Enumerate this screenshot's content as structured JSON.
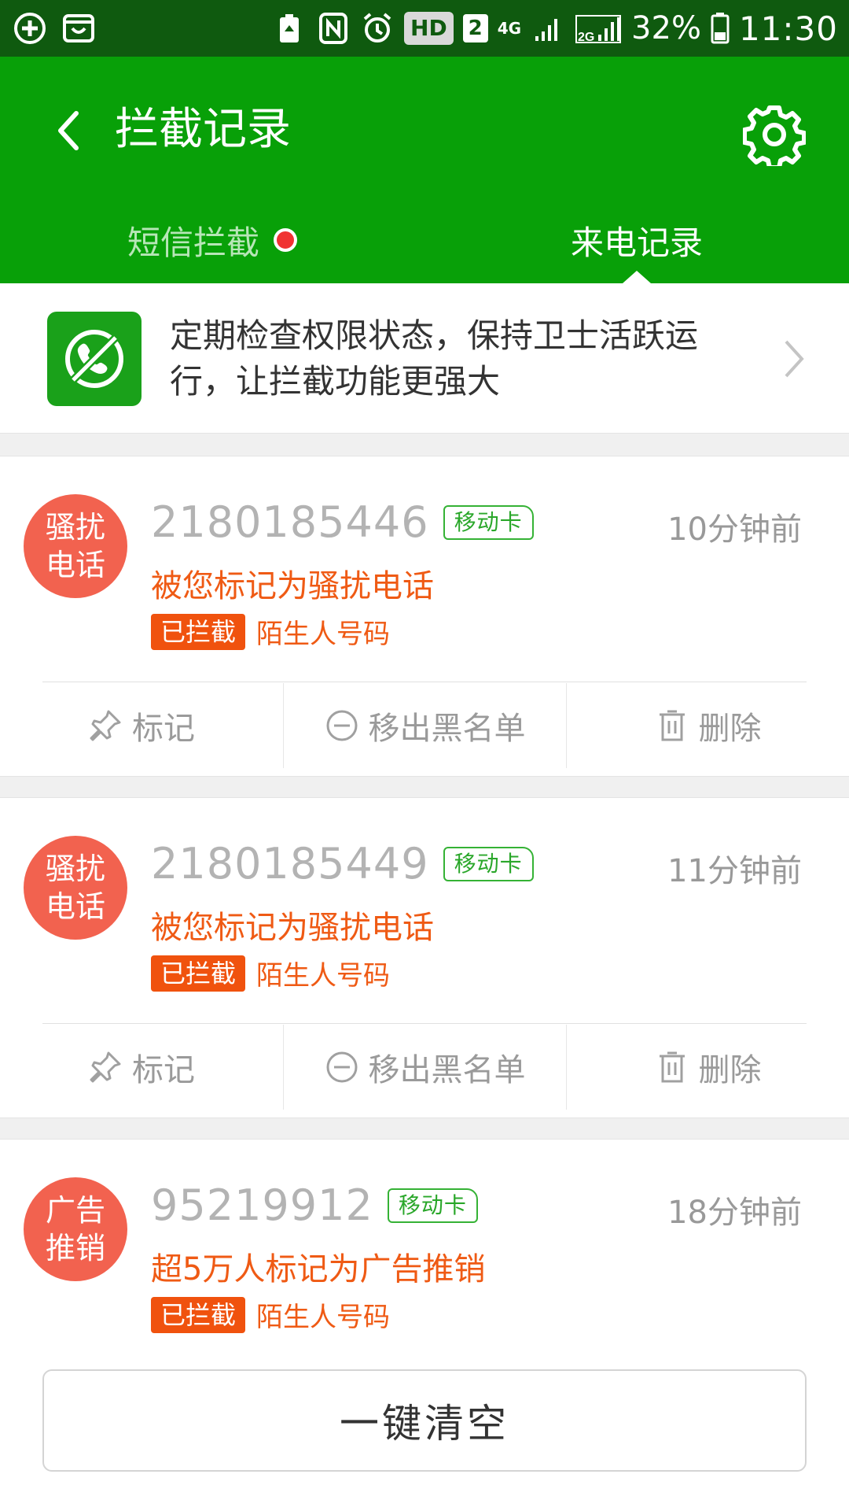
{
  "status_bar": {
    "hd": "HD",
    "sim": "2",
    "network": "4G",
    "network2": "2G",
    "battery": "32%",
    "time": "11:30"
  },
  "header": {
    "title": "拦截记录"
  },
  "tabs": [
    {
      "label": "短信拦截",
      "has_dot": true
    },
    {
      "label": "来电记录",
      "active": true
    }
  ],
  "notice": {
    "text": "定期检查权限状态，保持卫士活跃运行，让拦截功能更强大"
  },
  "records": [
    {
      "avatar_line1": "骚扰",
      "avatar_line2": "电话",
      "number": "2180185446",
      "sim": "移动卡",
      "time": "10分钟前",
      "desc": "被您标记为骚扰电话",
      "blocked": "已拦截",
      "tag": "陌生人号码"
    },
    {
      "avatar_line1": "骚扰",
      "avatar_line2": "电话",
      "number": "2180185449",
      "sim": "移动卡",
      "time": "11分钟前",
      "desc": "被您标记为骚扰电话",
      "blocked": "已拦截",
      "tag": "陌生人号码"
    },
    {
      "avatar_line1": "广告",
      "avatar_line2": "推销",
      "number": "95219912",
      "sim": "移动卡",
      "time": "18分钟前",
      "desc": "超5万人标记为广告推销",
      "blocked": "已拦截",
      "tag": "陌生人号码"
    }
  ],
  "actions": {
    "mark": "标记",
    "remove": "移出黑名单",
    "delete": "删除"
  },
  "clear_button": "一键清空",
  "colors": {
    "status_bar": "#0f5a0f",
    "brand_green": "#08a008",
    "avatar_red": "#f2624f",
    "warning_orange": "#ef5a14"
  }
}
